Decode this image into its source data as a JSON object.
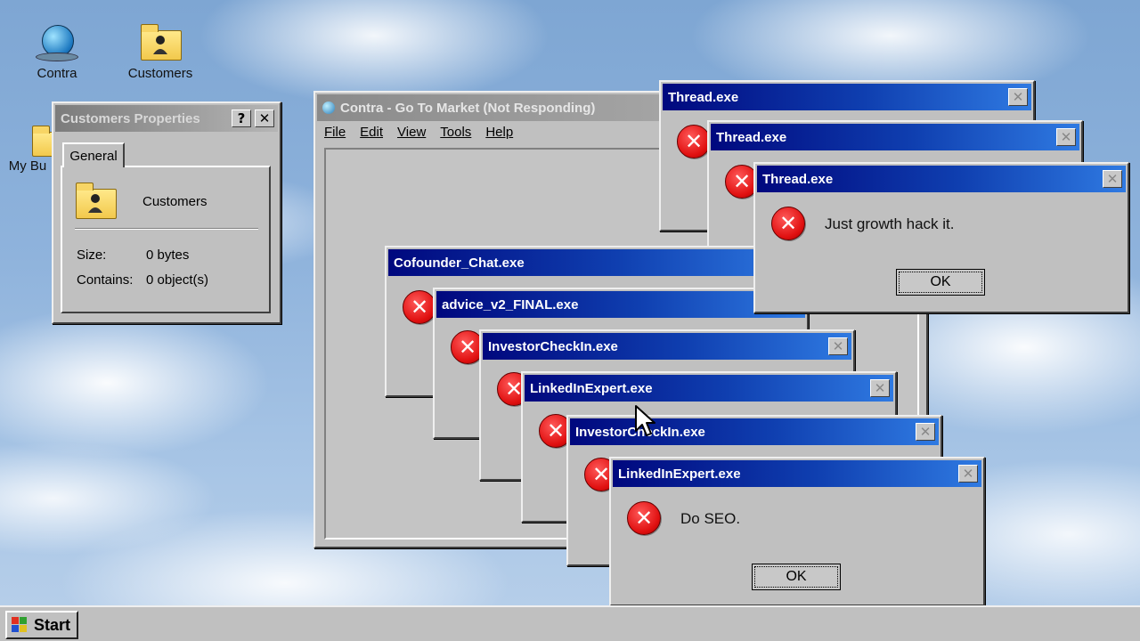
{
  "desktop": {
    "icons": [
      {
        "label": "Contra",
        "icon": "globe-icon"
      },
      {
        "label": "Customers",
        "icon": "folder-icon"
      },
      {
        "label": "My Bu",
        "icon": "briefcase-icon"
      }
    ]
  },
  "properties": {
    "title": "Customers Properties",
    "help_btn": "?",
    "close_btn": "✕",
    "tab": "General",
    "name": "Customers",
    "size_label": "Size:",
    "size_value": "0 bytes",
    "contains_label": "Contains:",
    "contains_value": "0 object(s)"
  },
  "main_window": {
    "title": "Contra - Go To Market (Not Responding)",
    "menu": [
      "File",
      "Edit",
      "View",
      "Tools",
      "Help"
    ]
  },
  "dialogs": {
    "thread1": {
      "title": "Thread.exe"
    },
    "thread2": {
      "title": "Thread.exe"
    },
    "thread3": {
      "title": "Thread.exe",
      "message": "Just growth hack it.",
      "ok": "OK"
    },
    "cofounder": {
      "title": "Cofounder_Chat.exe"
    },
    "advice": {
      "title": "advice_v2_FINAL.exe"
    },
    "investor1": {
      "title": "InvestorCheckIn.exe"
    },
    "linkedin1": {
      "title": "LinkedInExpert.exe"
    },
    "investor2": {
      "title": "InvestorCheckIn.exe"
    },
    "linkedin2": {
      "title": "LinkedInExpert.exe",
      "message": "Do SEO.",
      "ok": "OK"
    }
  },
  "taskbar": {
    "start_label": "Start"
  },
  "colors": {
    "title_active_start": "#00087e",
    "title_active_end": "#2f7ae2",
    "error_red": "#e01010"
  }
}
